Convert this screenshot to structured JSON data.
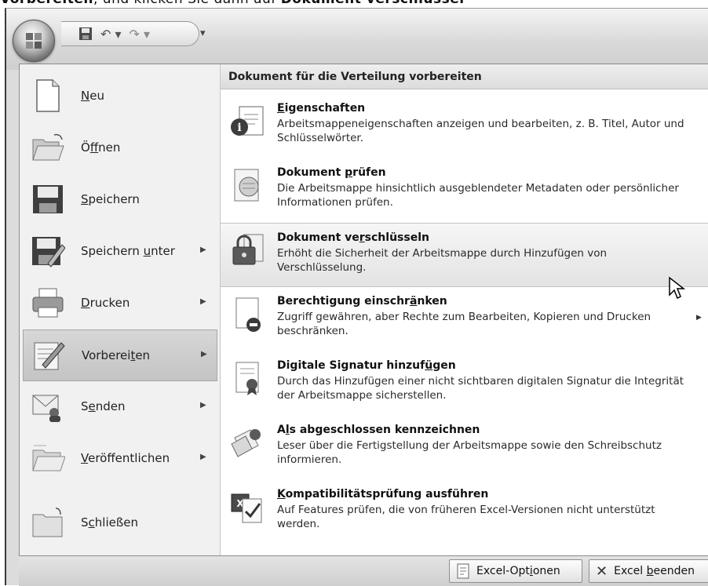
{
  "doc_text": {
    "part1": "Vorbereiten",
    "part2": ", und klicken Sie dann auf ",
    "part3": "Dokument verschlüssel"
  },
  "office_button": {
    "icon": "office-logo-icon"
  },
  "quick_access": {
    "save_icon": "save-icon",
    "undo_icon": "undo-icon",
    "redo_icon": "redo-icon",
    "customize_icon": "customize-qat-icon"
  },
  "left_menu": [
    {
      "pre": "",
      "key": "N",
      "post": "eu",
      "icon": "new-document-icon",
      "has_submenu": false
    },
    {
      "pre": "Ö",
      "key": "f",
      "post": "fnen",
      "icon": "open-folder-icon",
      "has_submenu": false
    },
    {
      "pre": "",
      "key": "S",
      "post": "peichern",
      "icon": "save-disk-icon",
      "has_submenu": false
    },
    {
      "pre": "Speichern ",
      "key": "u",
      "post": "nter",
      "icon": "save-as-icon",
      "has_submenu": true
    },
    {
      "pre": "",
      "key": "D",
      "post": "rucken",
      "icon": "printer-icon",
      "has_submenu": true
    },
    {
      "pre": "Vorberei",
      "key": "t",
      "post": "en",
      "icon": "prepare-icon",
      "has_submenu": true,
      "selected": true
    },
    {
      "pre": "S",
      "key": "e",
      "post": "nden",
      "icon": "send-icon",
      "has_submenu": true
    },
    {
      "pre": "",
      "key": "V",
      "post": "eröffentlichen",
      "icon": "publish-icon",
      "has_submenu": true
    },
    {
      "pre": "S",
      "key": "c",
      "post": "hließen",
      "icon": "close-folder-icon",
      "has_submenu": false
    }
  ],
  "submenu": {
    "header": "Dokument für die Verteilung vorbereiten",
    "items": [
      {
        "t_pre": "",
        "t_key": "E",
        "t_post": "igenschaften",
        "desc": "Arbeitsmappeneigenschaften anzeigen und bearbeiten, z. B. Titel, Autor und Schlüsselwörter.",
        "icon": "properties-icon"
      },
      {
        "t_pre": "Dokument ",
        "t_key": "p",
        "t_post": "rüfen",
        "desc": "Die Arbeitsmappe hinsichtlich ausgeblendeter Metadaten oder persönlicher Informationen prüfen.",
        "icon": "inspect-document-icon"
      },
      {
        "t_pre": "Dokument ve",
        "t_key": "r",
        "t_post": "schlüsseln",
        "desc": "Erhöht die Sicherheit der Arbeitsmappe durch Hinzufügen von Verschlüsselung.",
        "icon": "encrypt-lock-icon",
        "hover": true
      },
      {
        "t_pre": "Berechtigung einschr",
        "t_key": "ä",
        "t_post": "nken",
        "desc": "Zugriff gewähren, aber Rechte zum Bearbeiten, Kopieren und Drucken beschränken.",
        "icon": "restrict-permission-icon",
        "has_submenu": true
      },
      {
        "t_pre": "Digitale Signatur hinzuf",
        "t_key": "ü",
        "t_post": "gen",
        "desc": "Durch das Hinzufügen einer nicht sichtbaren digitalen Signatur die Integrität der Arbeitsmappe sicherstellen.",
        "icon": "digital-signature-icon"
      },
      {
        "t_pre": "A",
        "t_key": "l",
        "t_post": "s abgeschlossen kennzeichnen",
        "desc": "Leser über die Fertigstellung der Arbeitsmappe sowie den Schreibschutz informieren.",
        "icon": "mark-final-icon"
      },
      {
        "t_pre": "",
        "t_key": "K",
        "t_post": "ompatibilitätsprüfung ausführen",
        "desc": "Auf Features prüfen, die von früheren Excel-Versionen nicht unterstützt werden.",
        "icon": "compatibility-check-icon"
      }
    ]
  },
  "footer": {
    "options": {
      "pre": "Excel-Opt",
      "key": "i",
      "post": "onen",
      "icon": "options-icon"
    },
    "exit": {
      "pre": "Excel ",
      "key": "b",
      "post": "eenden",
      "icon": "exit-x-icon"
    }
  },
  "colors": {
    "selected_bg": "#c8c8c8",
    "menu_bg": "#f1f1f1",
    "submenu_bg": "#ffffff"
  }
}
